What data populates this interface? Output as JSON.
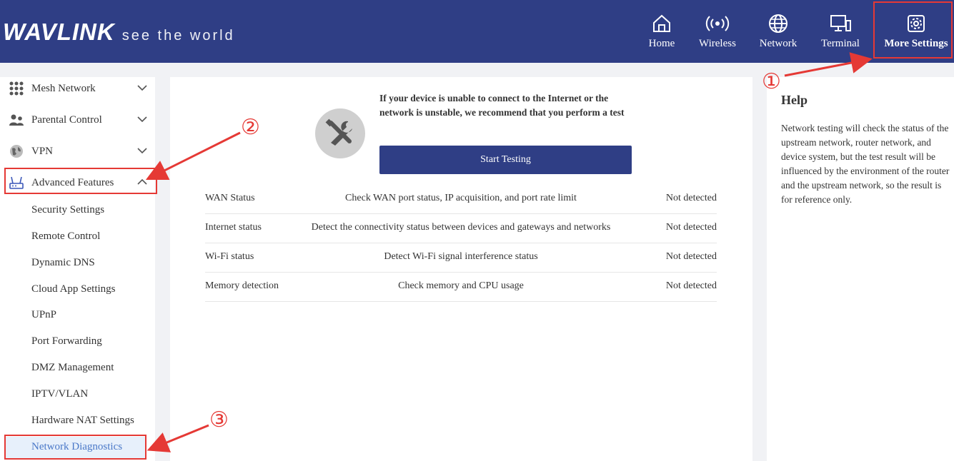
{
  "header": {
    "brand": "WAVLINK",
    "tagline": "see the world",
    "nav": [
      {
        "label": "Home",
        "icon": "home-icon"
      },
      {
        "label": "Wireless",
        "icon": "wireless-icon"
      },
      {
        "label": "Network",
        "icon": "globe-icon"
      },
      {
        "label": "Terminal",
        "icon": "terminal-icon"
      },
      {
        "label": "More Settings",
        "icon": "gear-icon",
        "active": true
      }
    ]
  },
  "sidebar": {
    "groups": [
      {
        "label": "Mesh Network",
        "icon": "mesh-grid-icon"
      },
      {
        "label": "Parental Control",
        "icon": "parental-icon"
      },
      {
        "label": "VPN",
        "icon": "vpn-globe-icon"
      },
      {
        "label": "Advanced Features",
        "icon": "router-icon",
        "expanded": true
      }
    ],
    "sub_items": [
      "Security Settings",
      "Remote Control",
      "Dynamic DNS",
      "Cloud App Settings",
      "UPnP",
      "Port Forwarding",
      "DMZ Management",
      "IPTV/VLAN",
      "Hardware NAT Settings",
      "Network Diagnostics"
    ],
    "active_sub": "Network Diagnostics"
  },
  "main": {
    "message": "If your device is unable to connect to the Internet or the network is unstable, we recommend that you perform a test",
    "button": "Start Testing",
    "rows": [
      {
        "name": "WAN Status",
        "desc": "Check WAN port status, IP acquisition, and port rate limit",
        "status": "Not detected"
      },
      {
        "name": "Internet status",
        "desc": "Detect the connectivity status between devices and gateways and networks",
        "status": "Not detected"
      },
      {
        "name": "Wi-Fi status",
        "desc": "Detect Wi-Fi signal interference status",
        "status": "Not detected"
      },
      {
        "name": "Memory detection",
        "desc": "Check memory and CPU usage",
        "status": "Not detected"
      }
    ]
  },
  "help": {
    "title": "Help",
    "text": "Network testing will check the status of the upstream network, router network, and device system, but the test result will be influenced by the environment of the router and the upstream network, so the result is for reference only."
  },
  "annotations": [
    "①",
    "②",
    "③"
  ],
  "colors": {
    "header": "#2f3e85",
    "annotation": "#e53935",
    "active_link": "#4a78c8"
  }
}
